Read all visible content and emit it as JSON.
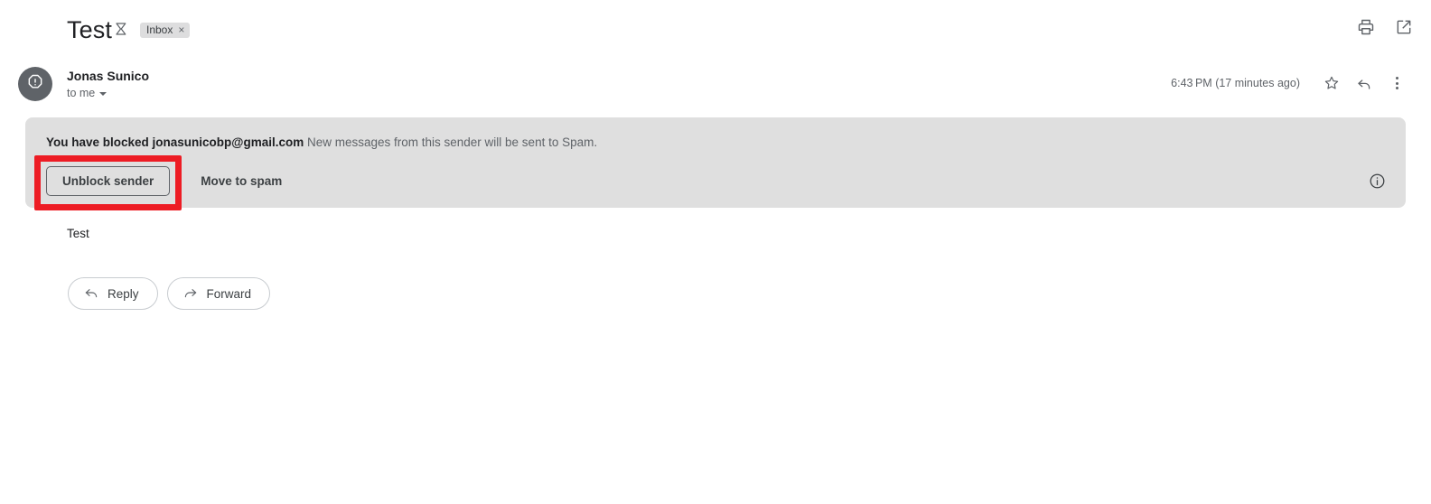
{
  "header": {
    "subject": "Test",
    "inbox_icon": "inbox-chevron-icon",
    "label_chip": "Inbox",
    "label_chip_remove": "×",
    "print_icon": "print-icon",
    "open_in_new_icon": "open-in-new-window-icon"
  },
  "sender": {
    "avatar_icon": "blocked-sender-octagon-icon",
    "name": "Jonas Sunico",
    "recipient": "to me",
    "timestamp": "6:43 PM (17 minutes ago)",
    "star_icon": "star-icon",
    "reply_icon": "reply-arrow-icon",
    "more_icon": "more-options-icon"
  },
  "banner": {
    "blocked_prefix": "You have blocked jonasunicobp@gmail.com",
    "blocked_suffix": " New messages from this sender will be sent to Spam.",
    "unblock_label": "Unblock sender",
    "move_to_spam_label": "Move to spam",
    "info_icon": "info-circle-icon",
    "background_color": "#dfdfdf",
    "highlight_color": "#ed1c24"
  },
  "message": {
    "body": "Test"
  },
  "actions": {
    "reply_label": "Reply",
    "reply_icon": "reply-arrow-icon",
    "forward_label": "Forward",
    "forward_icon": "forward-arrow-icon"
  }
}
